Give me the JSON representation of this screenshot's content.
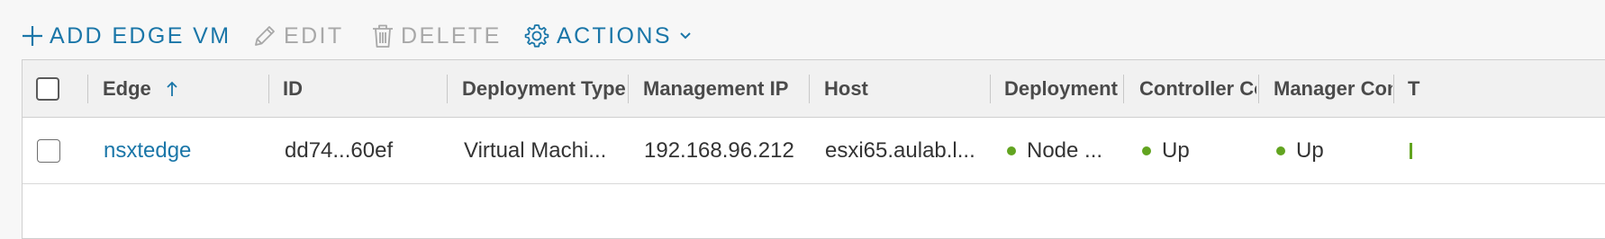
{
  "toolbar": {
    "add_label": "ADD EDGE VM",
    "edit_label": "EDIT",
    "delete_label": "DELETE",
    "actions_label": "ACTIONS"
  },
  "table": {
    "columns": [
      "Edge",
      "ID",
      "Deployment Type",
      "Management IP",
      "Host",
      "Deployment Status",
      "Controller Connectivity",
      "Manager Connectivity",
      "T"
    ],
    "rows": [
      {
        "edge": "nsxtedge",
        "id": "dd74...60ef",
        "deployment_type": "Virtual Machi...",
        "management_ip": "192.168.96.212",
        "host": "esxi65.aulab.l...",
        "deployment_status": "Node ...",
        "controller": "Up",
        "manager": "Up"
      }
    ]
  },
  "colors": {
    "accent": "#1a76a8",
    "status_green": "#62a420",
    "disabled": "#a8a8a8"
  },
  "icons": {
    "add": "plus-icon",
    "edit": "pencil-icon",
    "delete": "trash-icon",
    "actions": "gear-icon",
    "dropdown": "chevron-down-icon",
    "sort": "arrow-up-icon"
  }
}
